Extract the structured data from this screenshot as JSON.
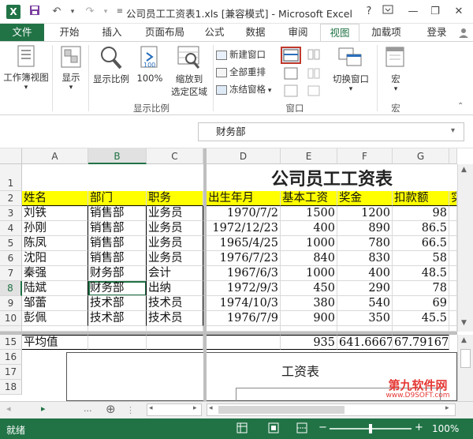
{
  "title_bar": {
    "title": "公司员工工资表1.xls [兼容模式] - Microsoft Excel",
    "help": "?",
    "login": "登录"
  },
  "tabs": [
    "文件",
    "开始",
    "插入",
    "页面布局",
    "公式",
    "数据",
    "审阅",
    "视图",
    "加载项"
  ],
  "active_tab": "视图",
  "ribbon": {
    "workbook_views": "工作簿视图",
    "show": "显示",
    "zoom": "显示比例",
    "zoom100": "100%",
    "zoom_selection_1": "缩放到",
    "zoom_selection_2": "选定区域",
    "zoom_group": "显示比例",
    "new_window": "新建窗口",
    "arrange_all": "全部重排",
    "freeze_panes": "冻结窗格",
    "window_group": "窗口",
    "switch_windows": "切换窗口",
    "macros": "宏",
    "macros_group": "宏"
  },
  "search_box": "财务部",
  "columns": [
    "A",
    "B",
    "C",
    "D",
    "E",
    "F",
    "G"
  ],
  "rows_top": [
    "1",
    "2",
    "3",
    "4",
    "5",
    "6",
    "7",
    "8",
    "9",
    "10"
  ],
  "rows_bottom": [
    "15",
    "16",
    "17",
    "18"
  ],
  "sheet": {
    "title": "公司员工工资表",
    "headers": [
      "姓名",
      "部门",
      "职务",
      "出生年月",
      "基本工资",
      "奖金",
      "扣款额",
      "实"
    ],
    "data": [
      [
        "刘铁",
        "销售部",
        "业务员",
        "1970/7/2",
        "1500",
        "1200",
        "98"
      ],
      [
        "孙刚",
        "销售部",
        "业务员",
        "1972/12/23",
        "400",
        "890",
        "86.5"
      ],
      [
        "陈凤",
        "销售部",
        "业务员",
        "1965/4/25",
        "1000",
        "780",
        "66.5"
      ],
      [
        "沈阳",
        "销售部",
        "业务员",
        "1976/7/23",
        "840",
        "830",
        "58"
      ],
      [
        "秦强",
        "财务部",
        "会计",
        "1967/6/3",
        "1000",
        "400",
        "48.5"
      ],
      [
        "陆斌",
        "财务部",
        "出纳",
        "1972/9/3",
        "450",
        "290",
        "78"
      ],
      [
        "邹蕾",
        "技术部",
        "技术员",
        "1974/10/3",
        "380",
        "540",
        "69"
      ],
      [
        "彭佩",
        "技术部",
        "技术员",
        "1976/7/9",
        "900",
        "350",
        "45.5"
      ]
    ],
    "average_label": "平均值",
    "averages": [
      "935",
      "641.6667",
      "67.79167"
    ],
    "chart_title": "工资表"
  },
  "sheet_bar": {
    "nav_next": "▸",
    "dots": "...",
    "add": "⊕"
  },
  "status": {
    "ready": "就绪",
    "zoom": "100%"
  },
  "watermark": {
    "line1": "第九软件网",
    "line2": "www.D9SOFT.com"
  },
  "colors": {
    "excel_green": "#217346",
    "header_yellow": "#ffff00",
    "highlight_red": "#c0392b"
  }
}
